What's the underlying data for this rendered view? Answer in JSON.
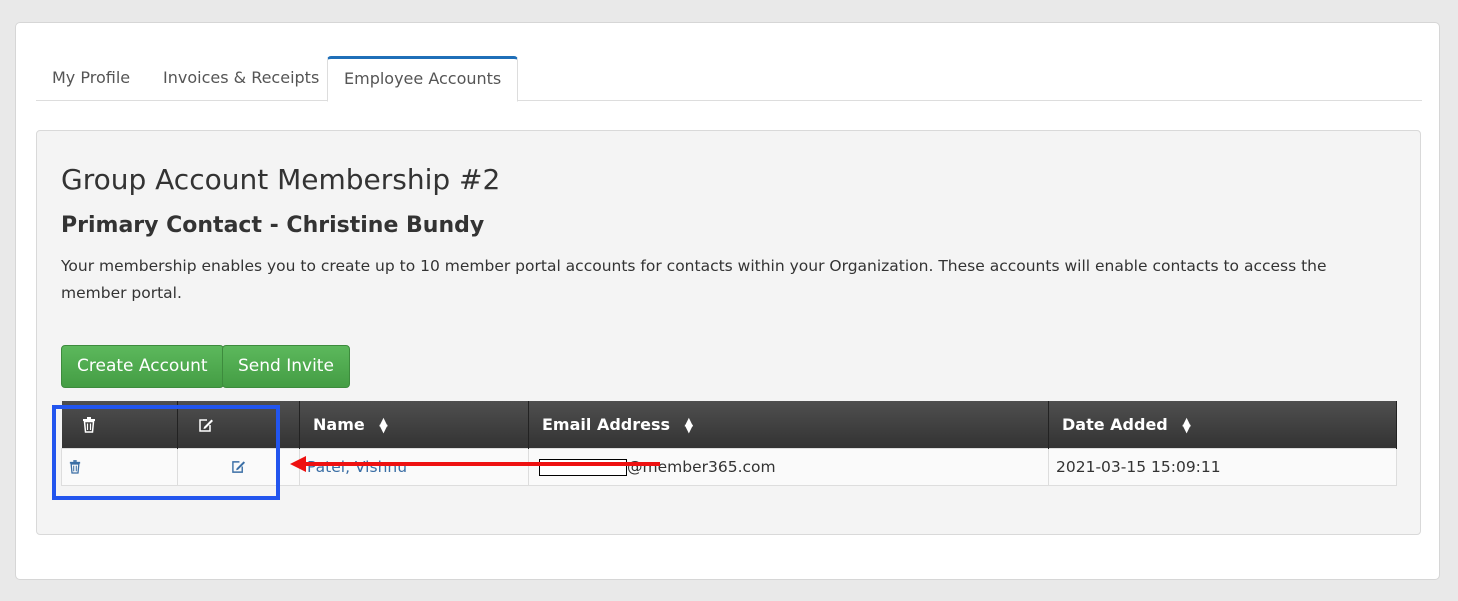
{
  "tabs": [
    {
      "label": "My Profile",
      "active": false
    },
    {
      "label": "Invoices & Receipts",
      "active": false
    },
    {
      "label": "Employee Accounts",
      "active": true
    }
  ],
  "panel": {
    "title": "Group Account Membership #2",
    "subtitle": "Primary Contact - Christine Bundy",
    "description": "Your membership enables you to create up to 10 member portal accounts for contacts within your Organization. These accounts will enable contacts to access the member portal."
  },
  "buttons": {
    "create_account": "Create Account",
    "send_invite": "Send Invite"
  },
  "table": {
    "columns": [
      {
        "label": "",
        "icon": "trash-icon"
      },
      {
        "label": "",
        "icon": "edit-icon"
      },
      {
        "label": "Name",
        "sortable": true
      },
      {
        "label": "Email Address",
        "sortable": true
      },
      {
        "label": "Date Added",
        "sortable": true
      }
    ],
    "rows": [
      {
        "delete_icon": "trash-icon",
        "edit_icon": "edit-icon",
        "name": "Patel, Vishnu",
        "email_domain": "@member365.com",
        "date_added": "2021-03-15 15:09:11"
      }
    ]
  },
  "colors": {
    "tab_accent": "#1f6fb8",
    "button_green": "#5cb85c",
    "header_dark": "#333333",
    "link_blue": "#3a6ea5",
    "annotation_box": "#2255ee",
    "annotation_arrow": "#ee1111"
  }
}
